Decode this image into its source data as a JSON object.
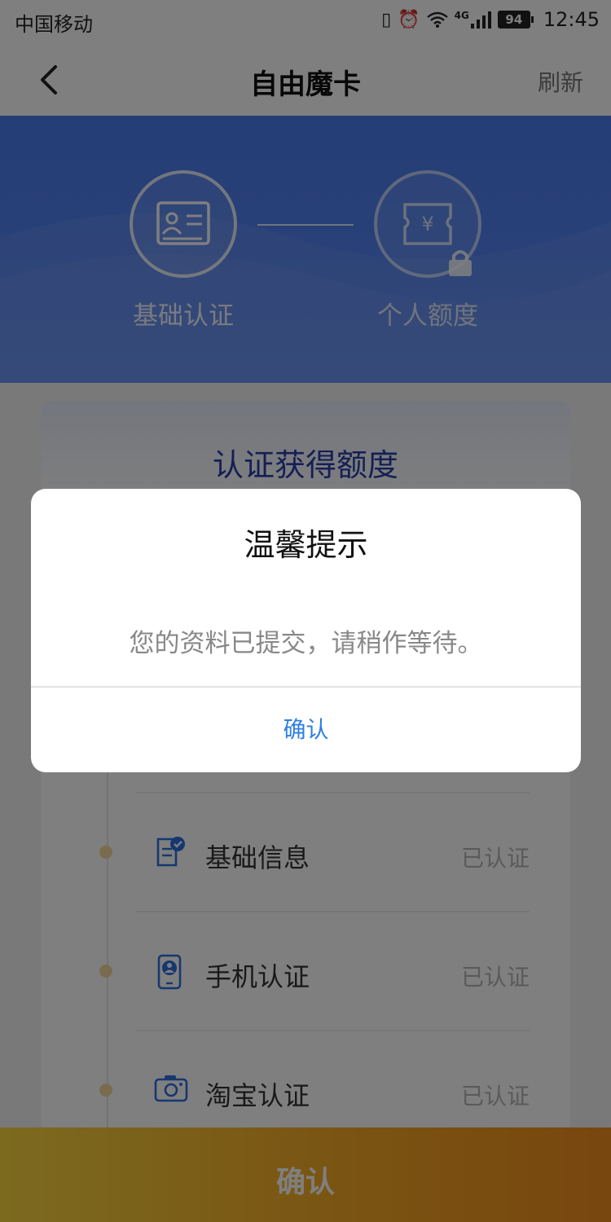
{
  "status_bar": {
    "carrier": "中国移动",
    "network": "4G",
    "battery": "94",
    "time": "12:45"
  },
  "nav": {
    "title": "自由魔卡",
    "refresh": "刷新"
  },
  "steps": [
    {
      "label": "基础认证",
      "icon": "id-card-icon"
    },
    {
      "label": "个人额度",
      "icon": "yen-ticket-icon",
      "locked": true
    }
  ],
  "card": {
    "title": "认证获得额度",
    "items": [
      {
        "label": "基础信息",
        "status": "已认证",
        "icon": "form-check-icon"
      },
      {
        "label": "手机认证",
        "status": "已认证",
        "icon": "phone-person-icon"
      },
      {
        "label": "淘宝认证",
        "status": "已认证",
        "icon": "camera-icon"
      }
    ]
  },
  "bottom_button": "确认",
  "dialog": {
    "title": "温馨提示",
    "message": "您的资料已提交，请稍作等待。",
    "confirm": "确认"
  },
  "colors": {
    "hero_blue": "#4b7bee",
    "dialog_button": "#2f7fe0",
    "bottom_orange": "#f5a623"
  }
}
